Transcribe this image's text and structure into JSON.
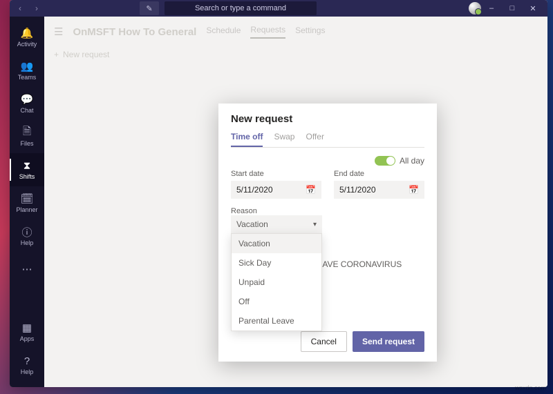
{
  "titlebar": {
    "search_placeholder": "Search or type a command"
  },
  "rail": {
    "items": [
      {
        "label": "Activity",
        "iconGlyph": "🔔"
      },
      {
        "label": "Teams",
        "iconGlyph": "👥"
      },
      {
        "label": "Chat",
        "iconGlyph": "💬"
      },
      {
        "label": "Files",
        "iconGlyph": "🗎"
      },
      {
        "label": "Shifts",
        "iconGlyph": "⧗"
      },
      {
        "label": "Planner",
        "iconGlyph": "🗓"
      },
      {
        "label": "Help",
        "iconGlyph": "ⓘ"
      }
    ],
    "more": "⋯",
    "apps": {
      "label": "Apps",
      "iconGlyph": "▦"
    },
    "help": {
      "label": "Help",
      "iconGlyph": "?"
    }
  },
  "header": {
    "team_title": "OnMSFT How To General",
    "tabs": [
      {
        "label": "Schedule"
      },
      {
        "label": "Requests"
      },
      {
        "label": "Settings"
      }
    ],
    "new_request_row": "New request",
    "plus_glyph": "+"
  },
  "modal": {
    "title": "New request",
    "tabs": [
      {
        "label": "Time off"
      },
      {
        "label": "Swap"
      },
      {
        "label": "Offer"
      }
    ],
    "allday_label": "All day",
    "start": {
      "label": "Start date",
      "value": "5/11/2020"
    },
    "end": {
      "label": "End date",
      "value": "5/11/2020"
    },
    "reason": {
      "label": "Reason",
      "selected": "Vacation",
      "options": [
        "Vacation",
        "Sick Day",
        "Unpaid",
        "Off",
        "Parental Leave"
      ]
    },
    "note_value": "I HAVE CORONAVIRUS",
    "buttons": {
      "cancel": "Cancel",
      "send": "Send request"
    }
  },
  "watermark": "wsxdn.com"
}
